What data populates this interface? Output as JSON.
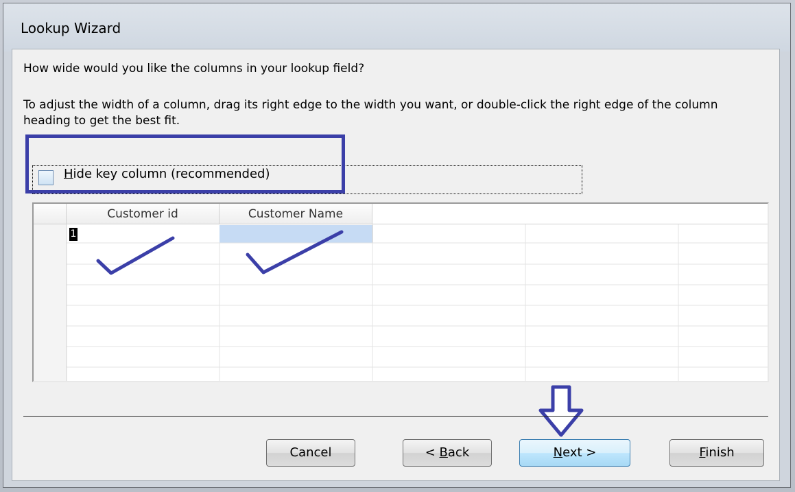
{
  "window": {
    "title": "Lookup Wizard"
  },
  "question": "How wide would you like the columns in your lookup field?",
  "instruction": "To adjust the width of a column, drag its right edge to the width you want, or double-click the right edge of the column heading to get the best fit.",
  "hide_key": {
    "checked": false,
    "label_mnemonic": "H",
    "label_rest": "ide key column (recommended)"
  },
  "grid": {
    "columns": [
      "Customer id",
      "Customer Name"
    ],
    "rows": [
      [
        "1",
        ""
      ]
    ],
    "selected_cell_color": "#c6dbf4"
  },
  "buttons": {
    "cancel": "Cancel",
    "back_prefix": "< ",
    "back_mnemonic": "B",
    "back_rest": "ack",
    "next_mnemonic": "N",
    "next_rest": "ext >",
    "finish_mnemonic": "F",
    "finish_rest": "inish"
  },
  "annotations": {
    "color": "#3b3fa8"
  }
}
